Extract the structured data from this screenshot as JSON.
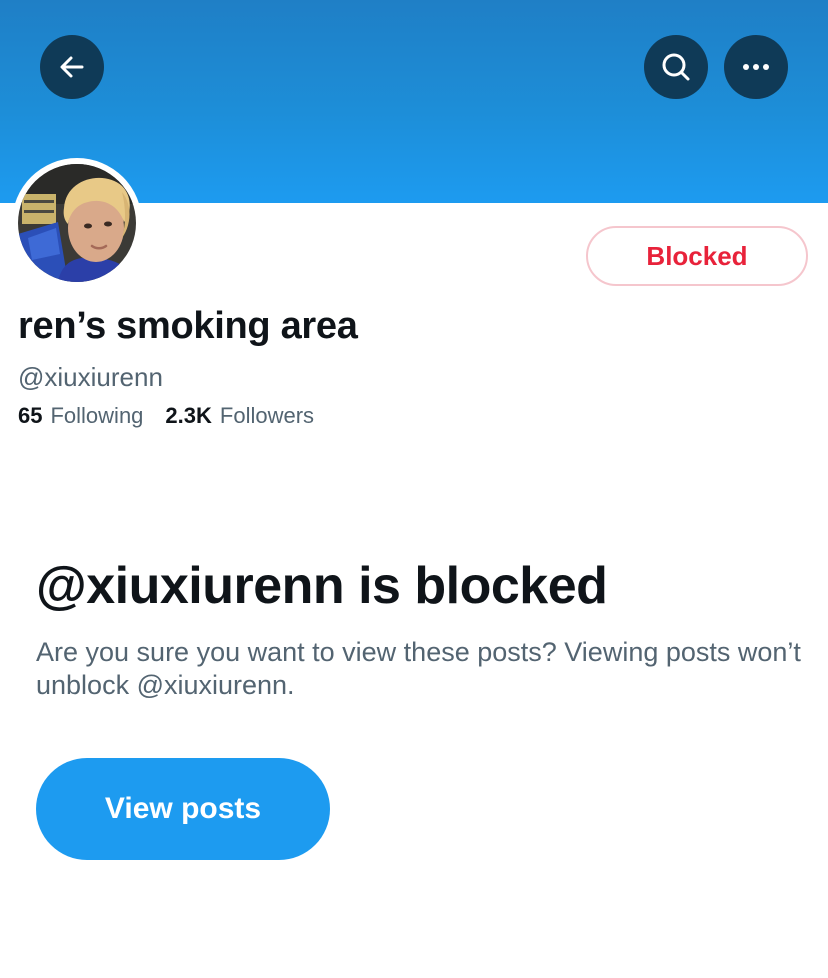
{
  "header": {
    "back_icon": "arrow-left-icon",
    "search_icon": "search-icon",
    "more_icon": "more-horizontal-icon",
    "banner_color": "#1d9bf0",
    "button_color": "#0f3a57"
  },
  "profile": {
    "avatar_icon": "avatar",
    "blocked_label": "Blocked",
    "display_name": "ren’s smoking area",
    "handle": "@xiuxiurenn",
    "following_count": "65",
    "following_label": "Following",
    "followers_count": "2.3K",
    "followers_label": "Followers"
  },
  "blocked_notice": {
    "heading": "@xiuxiurenn is blocked",
    "description": "Are you sure you want to view these posts? Viewing posts won’t unblock @xiuxiurenn.",
    "view_posts_label": "View posts",
    "accent_color": "#1d9bf0",
    "blocked_color": "#e8223a"
  }
}
